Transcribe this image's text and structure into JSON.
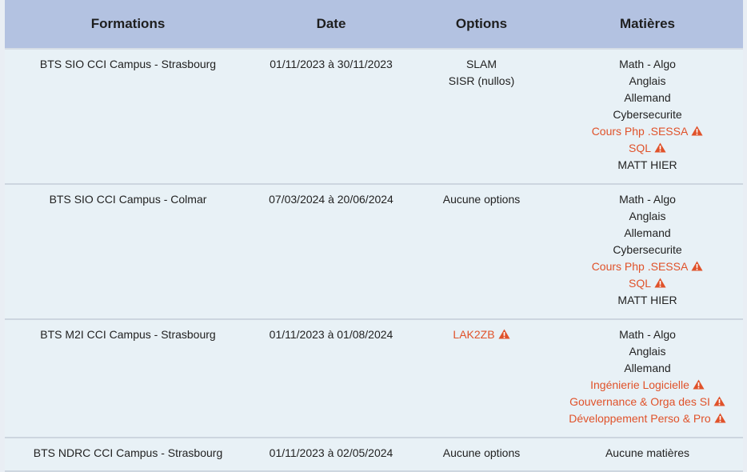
{
  "headers": {
    "formations": "Formations",
    "date": "Date",
    "options": "Options",
    "matieres": "Matières"
  },
  "colors": {
    "header_bg": "#b3c2e1",
    "row_bg": "#e8f1f6",
    "warning": "#e0522a"
  },
  "rows": [
    {
      "formation": "BTS SIO CCI Campus - Strasbourg",
      "date": "01/11/2023 à 30/11/2023",
      "options": [
        {
          "label": "SLAM",
          "warning": false
        },
        {
          "label": "SISR (nullos)",
          "warning": false
        }
      ],
      "matieres": [
        {
          "label": "Math - Algo",
          "warning": false
        },
        {
          "label": "Anglais",
          "warning": false
        },
        {
          "label": "Allemand",
          "warning": false
        },
        {
          "label": "Cybersecurite",
          "warning": false
        },
        {
          "label": "Cours Php .SESSA",
          "warning": true
        },
        {
          "label": "SQL",
          "warning": true
        },
        {
          "label": "MATT HIER",
          "warning": false
        }
      ]
    },
    {
      "formation": "BTS SIO CCI Campus - Colmar",
      "date": "07/03/2024 à 20/06/2024",
      "options": [
        {
          "label": "Aucune options",
          "warning": false
        }
      ],
      "matieres": [
        {
          "label": "Math - Algo",
          "warning": false
        },
        {
          "label": "Anglais",
          "warning": false
        },
        {
          "label": "Allemand",
          "warning": false
        },
        {
          "label": "Cybersecurite",
          "warning": false
        },
        {
          "label": "Cours Php .SESSA",
          "warning": true
        },
        {
          "label": "SQL",
          "warning": true
        },
        {
          "label": "MATT HIER",
          "warning": false
        }
      ]
    },
    {
      "formation": "BTS M2I CCI Campus - Strasbourg",
      "date": "01/11/2023 à 01/08/2024",
      "options": [
        {
          "label": "LAK2ZB",
          "warning": true
        }
      ],
      "matieres": [
        {
          "label": "Math - Algo",
          "warning": false
        },
        {
          "label": "Anglais",
          "warning": false
        },
        {
          "label": "Allemand",
          "warning": false
        },
        {
          "label": "Ingénierie Logicielle",
          "warning": true
        },
        {
          "label": "Gouvernance & Orga des SI",
          "warning": true
        },
        {
          "label": "Développement Perso & Pro",
          "warning": true
        }
      ]
    },
    {
      "formation": "BTS NDRC CCI Campus - Strasbourg",
      "date": "01/11/2023 à 02/05/2024",
      "options": [
        {
          "label": "Aucune options",
          "warning": false
        }
      ],
      "matieres": [
        {
          "label": "Aucune matières",
          "warning": false
        }
      ]
    }
  ]
}
